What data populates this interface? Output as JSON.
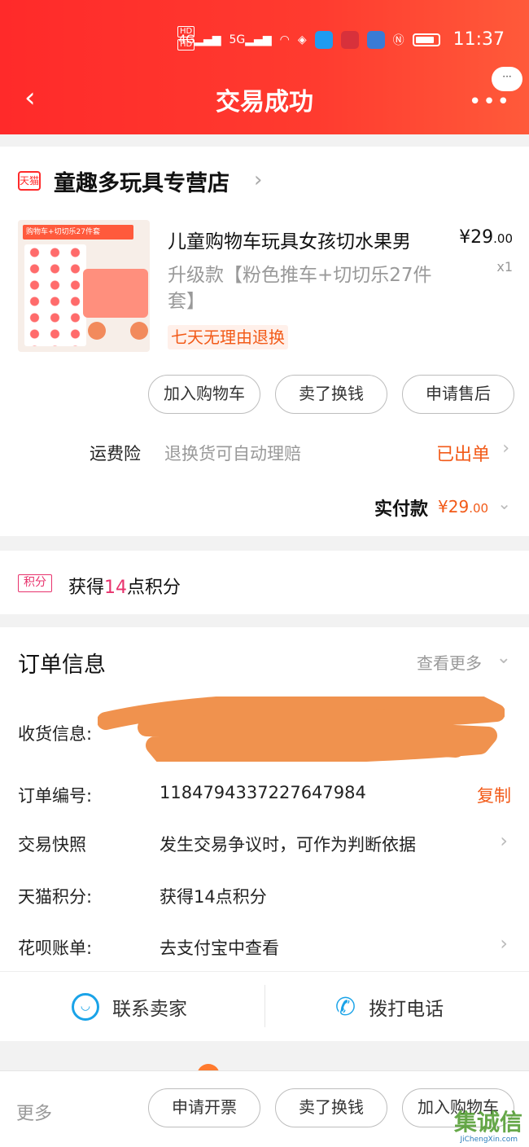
{
  "statusbar": {
    "hd1": "HD",
    "hd2": "HD",
    "sig1": "4G",
    "sig2": "5G",
    "time": "11:37"
  },
  "header": {
    "title": "交易成功",
    "bubble": "···"
  },
  "shop": {
    "logo_text": "天猫",
    "name": "童趣多玩具专营店"
  },
  "product": {
    "image_tag": "购物车+切切乐27件套",
    "title": "儿童购物车玩具女孩切水果男",
    "price_main": "¥29",
    "price_decimal": ".00",
    "quantity": "x1",
    "spec": "升级款【粉色推车+切切乐27件套】",
    "badge": "七天无理由退换"
  },
  "actions": {
    "add_cart": "加入购物车",
    "resell": "卖了换钱",
    "after_sale": "申请售后"
  },
  "insurance": {
    "label": "运费险",
    "desc": "退换货可自动理赔",
    "status": "已出单"
  },
  "payment": {
    "label": "实付款",
    "value_main": "¥29",
    "value_decimal": ".00"
  },
  "points": {
    "badge": "积分",
    "prefix": "获得",
    "number": "14",
    "suffix": "点积分"
  },
  "order_info": {
    "title": "订单信息",
    "more": "查看更多",
    "rows": [
      {
        "label": "收货信息:",
        "value": ""
      },
      {
        "label": "订单编号:",
        "value": "1184794337227647984"
      },
      {
        "label": "交易快照",
        "value": "发生交易争议时，可作为判断依据"
      },
      {
        "label": "天猫积分:",
        "value": "获得14点积分"
      },
      {
        "label": "花呗账单:",
        "value": "去支付宝中查看"
      }
    ],
    "copy": "复制"
  },
  "contact": {
    "seller": "联系卖家",
    "call": "拨打电话"
  },
  "bottom_bar": {
    "more": "更多",
    "invoice": "申请开票",
    "resell": "卖了换钱",
    "add_cart": "加入购物车"
  },
  "watermark": {
    "text": "集诚信",
    "sub": "JiChengXin.com"
  },
  "colors": {
    "header_red": "#ff2a2a",
    "accent_orange": "#f25a18",
    "points_pink": "#e8336d",
    "contact_blue": "#1aa3e8",
    "redaction_orange": "#f0924e"
  }
}
